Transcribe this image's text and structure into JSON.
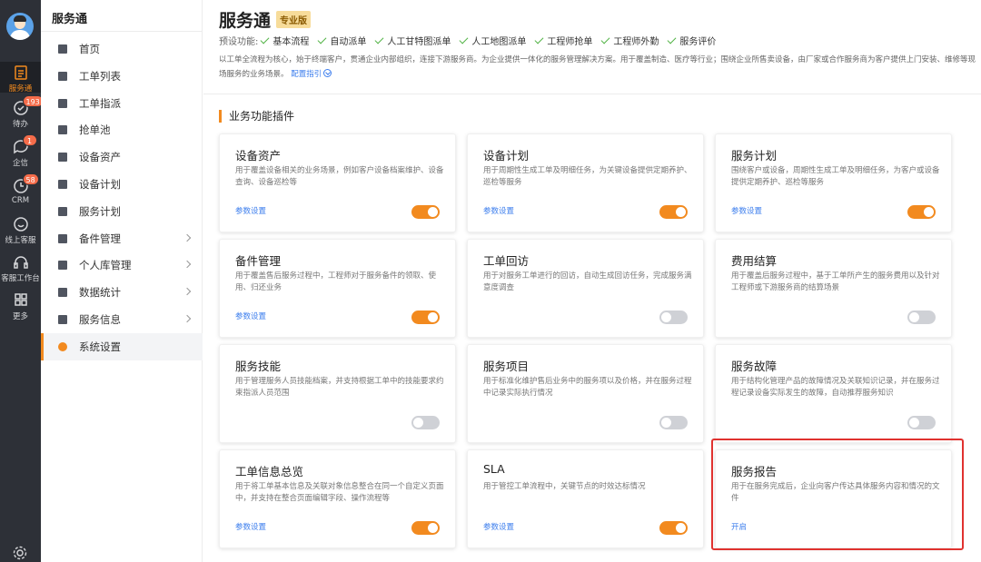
{
  "rail": {
    "items": [
      {
        "label": "服务通",
        "icon": "service-icon"
      },
      {
        "label": "待办",
        "icon": "todo-icon",
        "badge": "193"
      },
      {
        "label": "企信",
        "icon": "chat-icon",
        "badge": "1"
      },
      {
        "label": "CRM",
        "icon": "crm-icon",
        "badge": "58"
      },
      {
        "label": "线上客服",
        "icon": "smile-icon"
      },
      {
        "label": "客服工作台",
        "icon": "headset-icon"
      },
      {
        "label": "更多",
        "icon": "grid-icon"
      }
    ]
  },
  "sidebar": {
    "title": "服务通",
    "items": [
      {
        "label": "首页",
        "icon": "home-icon"
      },
      {
        "label": "工单列表",
        "icon": "list-icon"
      },
      {
        "label": "工单指派",
        "icon": "assign-icon"
      },
      {
        "label": "抢单池",
        "icon": "pool-icon"
      },
      {
        "label": "设备资产",
        "icon": "device-icon"
      },
      {
        "label": "设备计划",
        "icon": "device-plan-icon"
      },
      {
        "label": "服务计划",
        "icon": "service-plan-icon"
      },
      {
        "label": "备件管理",
        "icon": "parts-icon"
      },
      {
        "label": "个人库管理",
        "icon": "warehouse-icon"
      },
      {
        "label": "数据统计",
        "icon": "chart-icon"
      },
      {
        "label": "服务信息",
        "icon": "info-icon"
      },
      {
        "label": "系统设置",
        "icon": "settings-icon"
      }
    ]
  },
  "header": {
    "title": "服务通",
    "edition": "专业版",
    "features_label": "预设功能:",
    "features": [
      "基本流程",
      "自动派单",
      "人工甘特图派单",
      "人工地图派单",
      "工程师抢单",
      "工程师外勤",
      "服务评价"
    ],
    "description": "以工单全流程为核心，始于终端客户，贯通企业内部组织，连接下游服务商。为企业提供一体化的服务管理解决方案。用于覆盖制造、医疗等行业；围绕企业所售卖设备，由厂家或合作服务商为客户提供上门安装、维修等现场服务的业务场景。",
    "guide_link": "配置指引"
  },
  "section_title": "业务功能插件",
  "cards": [
    {
      "title": "设备资产",
      "desc": "用于覆盖设备相关的业务场景，例如客户设备档案维护、设备查询、设备巡检等",
      "link": "参数设置",
      "enabled": true
    },
    {
      "title": "设备计划",
      "desc": "用于周期性生成工单及明细任务，为关键设备提供定期养护、巡检等服务",
      "link": "参数设置",
      "enabled": true
    },
    {
      "title": "服务计划",
      "desc": "围绕客户或设备，周期性生成工单及明细任务，为客户或设备提供定期养护、巡检等服务",
      "link": "参数设置",
      "enabled": true
    },
    {
      "title": "备件管理",
      "desc": "用于覆盖售后服务过程中，工程师对于服务备件的领取、使用、归还业务",
      "link": "参数设置",
      "enabled": true
    },
    {
      "title": "工单回访",
      "desc": "用于对服务工单进行的回访，自动生成回访任务，完成服务满意度调查",
      "link": "",
      "enabled": false
    },
    {
      "title": "费用结算",
      "desc": "用于覆盖后服务过程中，基于工单所产生的服务费用以及针对工程师或下游服务商的结算场景",
      "link": "",
      "enabled": false
    },
    {
      "title": "服务技能",
      "desc": "用于管理服务人员技能档案，并支持根据工单中的技能要求约束指派人员范围",
      "link": "",
      "enabled": false
    },
    {
      "title": "服务项目",
      "desc": "用于标准化维护售后业务中的服务项以及价格，并在服务过程中记录实际执行情况",
      "link": "",
      "enabled": false
    },
    {
      "title": "服务故障",
      "desc": "用于结构化管理产品的故障情况及关联知识记录，并在服务过程记录设备实际发生的故障，自动推荐服务知识",
      "link": "",
      "enabled": false
    },
    {
      "title": "工单信息总览",
      "desc": "用于将工单基本信息及关联对象信息整合在同一个自定义页面中，并支持在整合页面编辑字段、操作流程等",
      "link": "参数设置",
      "enabled": true
    },
    {
      "title": "SLA",
      "desc": "用于管控工单流程中，关键节点的时效达标情况",
      "link": "参数设置",
      "enabled": true
    },
    {
      "title": "服务报告",
      "desc": "用于在服务完成后，企业向客户传达具体服务内容和情况的文件",
      "link": "开启",
      "enabled": null
    }
  ],
  "colors": {
    "accent": "#f28a1f",
    "link": "#3b7ded",
    "rail": "#2d3037",
    "highlight": "#e0322f"
  }
}
